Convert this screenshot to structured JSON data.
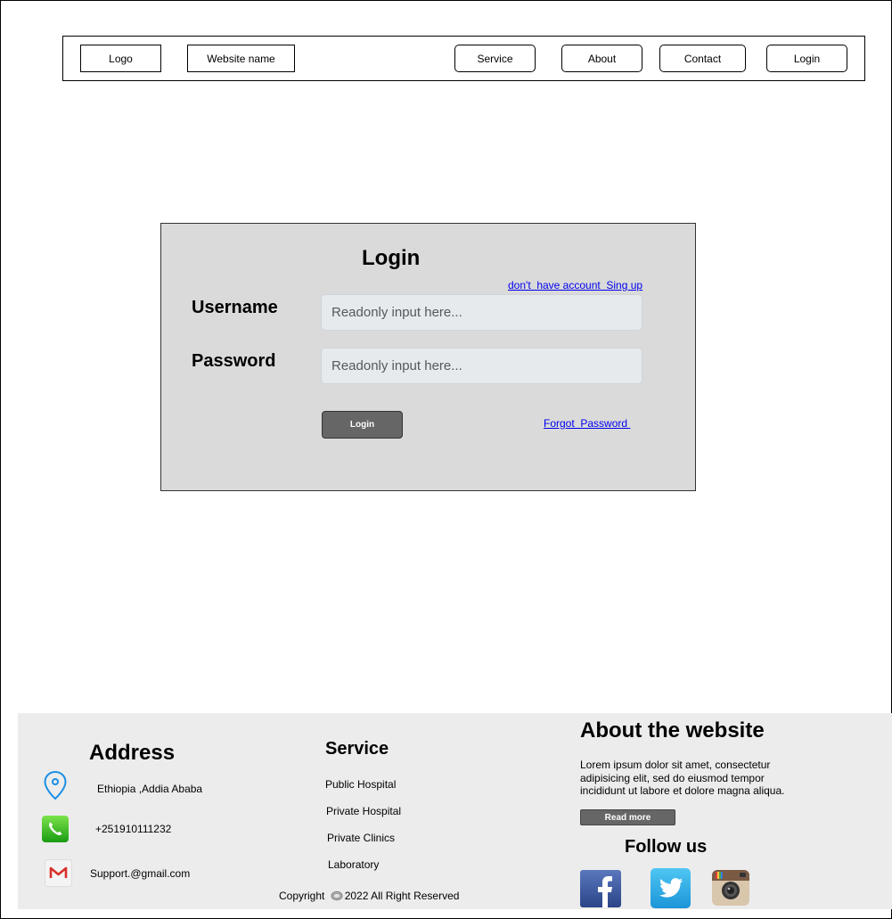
{
  "header": {
    "logo": "Logo",
    "website_name": "Website name",
    "nav": {
      "service": "Service",
      "about": "About",
      "contact": "Contact",
      "login": "Login"
    }
  },
  "login_form": {
    "title": "Login",
    "signup_link": "don't  have account  Sing up",
    "username_label": "Username",
    "username_placeholder": "Readonly input here...",
    "password_label": "Password",
    "password_placeholder": "Readonly input here...",
    "submit_label": "Login",
    "forgot_link": "Forgot  Password "
  },
  "footer": {
    "address": {
      "heading": "Address",
      "location": "Ethiopia ,Addia Ababa",
      "phone": "+251910111232",
      "email": "Support.@gmail.com"
    },
    "service": {
      "heading": "Service",
      "items": [
        "Public Hospital",
        "Private Hospital",
        "Private Clinics",
        "Laboratory"
      ]
    },
    "about": {
      "heading": "About the website",
      "text": "Lorem ipsum dolor sit amet, consectetur adipisicing elit, sed do eiusmod tempor incididunt ut labore et dolore magna aliqua.",
      "read_more": "Read more"
    },
    "follow": {
      "heading": "Follow us",
      "icons": [
        "facebook-icon",
        "twitter-icon",
        "instagram-icon"
      ]
    },
    "copyright": {
      "prefix": "Copyright ",
      "year_text": "2022 All Right Reserved"
    }
  },
  "colors": {
    "card_bg": "#dadada",
    "footer_bg": "#ececec",
    "button_bg": "#666666",
    "link": "#0000ee",
    "input_bg": "#e7eaed"
  }
}
